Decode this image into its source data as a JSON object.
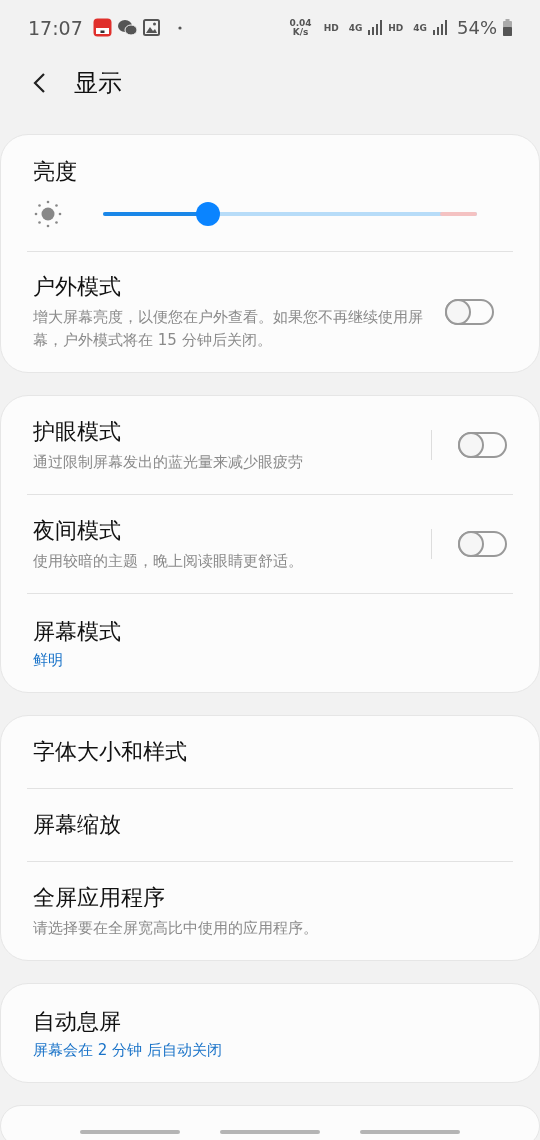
{
  "status_bar": {
    "time": "17:07",
    "speed_value": "0.04",
    "speed_unit": "K/s",
    "sims": [
      {
        "hd": "HD",
        "net": "4G"
      },
      {
        "hd": "HD",
        "net": "4G"
      }
    ],
    "battery": "54%"
  },
  "header": {
    "title": "显示"
  },
  "cards": [
    {
      "items": [
        {
          "kind": "slider",
          "title": "亮度",
          "level": 0.28
        },
        {
          "kind": "switch",
          "title": "户外模式",
          "subtitle": "增大屏幕亮度，以便您在户外查看。如果您不再继续使用屏幕，户外模式将在 15 分钟后关闭。",
          "on": false,
          "split": false
        }
      ]
    },
    {
      "items": [
        {
          "kind": "switch",
          "title": "护眼模式",
          "subtitle": "通过限制屏幕发出的蓝光量来减少眼疲劳",
          "on": false,
          "split": true
        },
        {
          "kind": "switch",
          "title": "夜间模式",
          "subtitle": "使用较暗的主题，晚上阅读眼睛更舒适。",
          "on": false,
          "split": true
        },
        {
          "kind": "link",
          "title": "屏幕模式",
          "value": "鲜明"
        }
      ]
    },
    {
      "items": [
        {
          "kind": "link",
          "title": "字体大小和样式"
        },
        {
          "kind": "link",
          "title": "屏幕缩放"
        },
        {
          "kind": "link",
          "title": "全屏应用程序",
          "subtitle": "请选择要在全屏宽高比中使用的应用程序。"
        }
      ]
    },
    {
      "items": [
        {
          "kind": "link",
          "title": "自动息屏",
          "value": "屏幕会在 2 分钟 后自动关闭"
        }
      ]
    }
  ]
}
